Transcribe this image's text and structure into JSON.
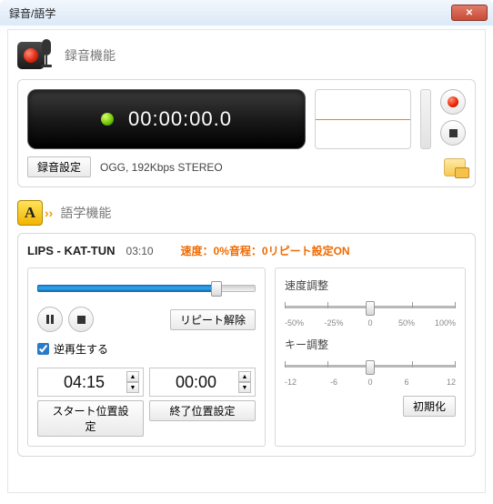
{
  "window": {
    "title": "録音/語学"
  },
  "recording": {
    "section_title": "録音機能",
    "time": "00:00:00.0",
    "settings_btn": "録音設定",
    "format": "OGG, 192Kbps STEREO"
  },
  "language": {
    "section_title": "語学機能",
    "track_title": "LIPS - KAT-TUN",
    "duration": "03:10",
    "speed_label": "速度：",
    "speed_val": "0%",
    "pitch_label": "音程：",
    "pitch_val": "0",
    "repeat_label": "リピート設定ON",
    "repeat_release_btn": "リピート解除",
    "reverse_label": "逆再生する",
    "start_time": "04:15",
    "end_time": "00:00",
    "start_btn": "スタート位置設定",
    "end_btn": "終了位置設定",
    "speed_adj_label": "速度調整",
    "speed_ticks": [
      "-50%",
      "-25%",
      "0",
      "50%",
      "100%"
    ],
    "key_adj_label": "キー調整",
    "key_ticks": [
      "-12",
      "-6",
      "0",
      "6",
      "12"
    ],
    "reset_btn": "初期化",
    "seek_percent": 82
  }
}
